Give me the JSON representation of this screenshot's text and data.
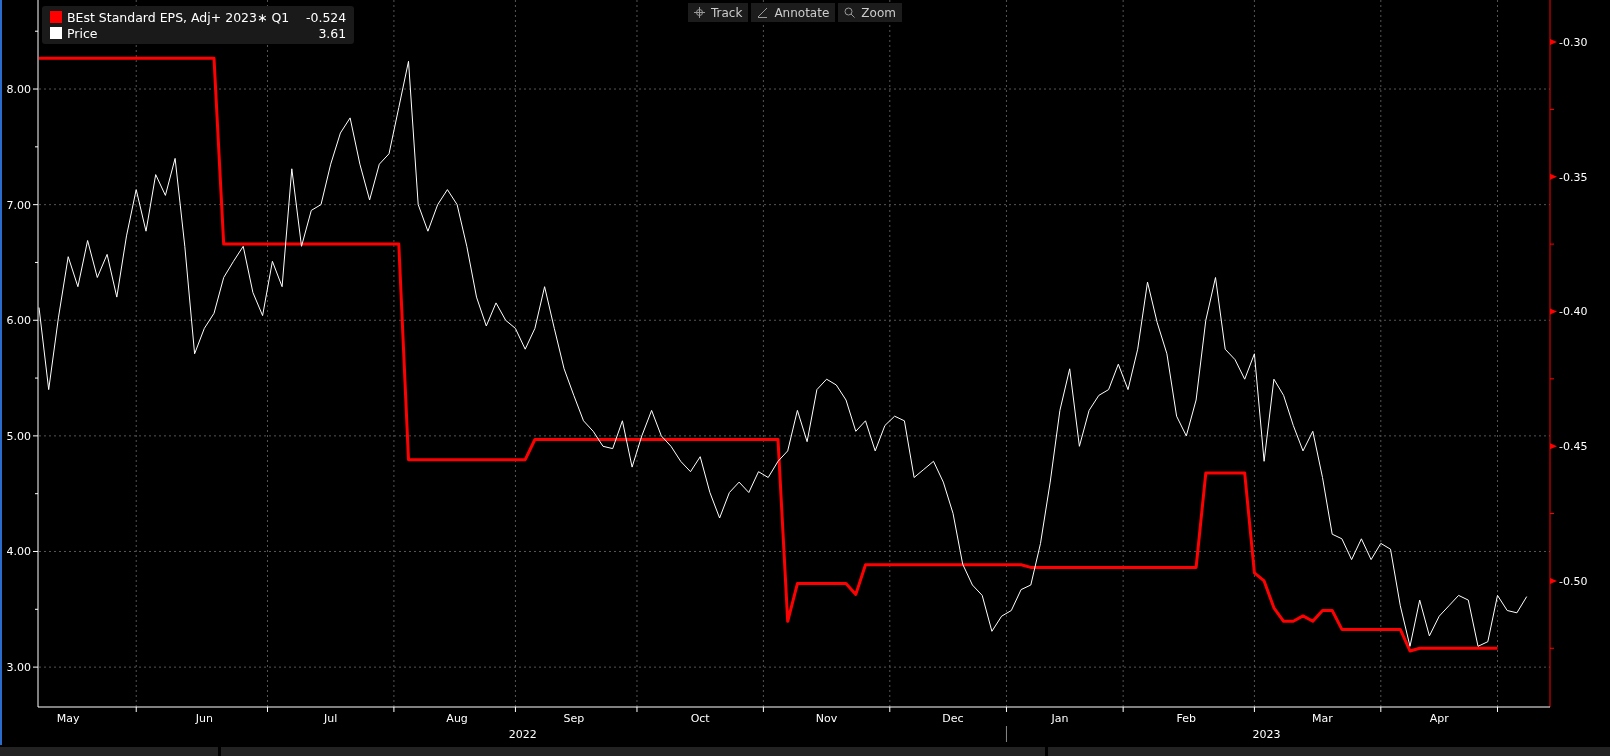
{
  "legend": [
    {
      "value": "-0.524"
    },
    {
      "value": "3.61"
    }
  ],
  "toolbar": [
    {
      "kind": "track",
      "label": "Track"
    },
    {
      "kind": "annotate",
      "label": "Annotate"
    },
    {
      "kind": "zoom",
      "label": "Zoom"
    }
  ],
  "chart_data": {
    "type": "line",
    "categories": [
      null,
      null,
      null,
      "May",
      null,
      null,
      null,
      null,
      null,
      null,
      null,
      null,
      null,
      null,
      null,
      null,
      null,
      "Jun",
      null,
      null,
      null,
      null,
      null,
      null,
      null,
      null,
      null,
      null,
      null,
      null,
      "Jul",
      null,
      null,
      null,
      null,
      null,
      null,
      null,
      null,
      null,
      null,
      null,
      null,
      "Aug",
      null,
      null,
      null,
      null,
      null,
      null,
      null,
      null,
      null,
      null,
      null,
      "Sep",
      null,
      null,
      null,
      null,
      null,
      null,
      null,
      null,
      null,
      null,
      null,
      null,
      "Oct",
      null,
      null,
      null,
      null,
      null,
      null,
      null,
      null,
      null,
      null,
      null,
      null,
      "Nov",
      null,
      null,
      null,
      null,
      null,
      null,
      null,
      null,
      null,
      null,
      null,
      null,
      "Dec",
      null,
      null,
      null,
      null,
      null,
      null,
      null,
      null,
      null,
      null,
      "Jan",
      null,
      null,
      null,
      null,
      null,
      null,
      null,
      null,
      null,
      null,
      null,
      null,
      "Feb",
      null,
      null,
      null,
      null,
      null,
      null,
      null,
      null,
      null,
      null,
      null,
      null,
      null,
      "Mar",
      null,
      null,
      null,
      null,
      null,
      null,
      null,
      null,
      null,
      null,
      null,
      "Apr",
      null,
      null,
      null,
      null,
      null,
      null,
      null,
      null,
      null
    ],
    "series": [
      {
        "name": "BEst Standard EPS, Adj+ 2023∗ Q1",
        "axis": "y2",
        "color": "#ff0000",
        "values": [
          -0.306,
          -0.306,
          -0.306,
          -0.306,
          -0.306,
          -0.306,
          -0.306,
          -0.306,
          -0.306,
          -0.306,
          -0.306,
          -0.306,
          -0.306,
          -0.306,
          -0.306,
          -0.306,
          -0.306,
          -0.306,
          -0.306,
          -0.375,
          -0.375,
          -0.375,
          -0.375,
          -0.375,
          -0.375,
          -0.375,
          -0.375,
          -0.375,
          -0.375,
          -0.375,
          -0.375,
          -0.375,
          -0.375,
          -0.375,
          -0.375,
          -0.375,
          -0.375,
          -0.375,
          -0.455,
          -0.455,
          -0.455,
          -0.455,
          -0.455,
          -0.455,
          -0.455,
          -0.455,
          -0.455,
          -0.455,
          -0.455,
          -0.455,
          -0.455,
          -0.4475,
          -0.4475,
          -0.4475,
          -0.4475,
          -0.4475,
          -0.4475,
          -0.4475,
          -0.4475,
          -0.4475,
          -0.4475,
          -0.4475,
          -0.4475,
          -0.4475,
          -0.4475,
          -0.4475,
          -0.4475,
          -0.4475,
          -0.4475,
          -0.4475,
          -0.4475,
          -0.4475,
          -0.4475,
          -0.4475,
          -0.4475,
          -0.4475,
          -0.4475,
          -0.515,
          -0.501,
          -0.501,
          -0.501,
          -0.501,
          -0.501,
          -0.501,
          -0.505,
          -0.494,
          -0.494,
          -0.494,
          -0.494,
          -0.494,
          -0.494,
          -0.494,
          -0.494,
          -0.494,
          -0.494,
          -0.494,
          -0.494,
          -0.494,
          -0.494,
          -0.494,
          -0.494,
          -0.494,
          -0.495,
          -0.495,
          -0.495,
          -0.495,
          -0.495,
          -0.495,
          -0.495,
          -0.495,
          -0.495,
          -0.495,
          -0.495,
          -0.495,
          -0.495,
          -0.495,
          -0.495,
          -0.495,
          -0.495,
          -0.495,
          -0.46,
          -0.46,
          -0.46,
          -0.46,
          -0.46,
          -0.497,
          -0.5,
          -0.51,
          -0.515,
          -0.515,
          -0.513,
          -0.515,
          -0.511,
          -0.511,
          -0.518,
          -0.518,
          -0.518,
          -0.518,
          -0.518,
          -0.518,
          -0.518,
          -0.526,
          -0.525,
          -0.525,
          -0.525,
          -0.525,
          -0.525,
          -0.525,
          -0.525,
          -0.525,
          -0.525,
          null,
          null,
          null
        ]
      },
      {
        "name": "Price",
        "color": "#ffffff",
        "values": [
          6.11,
          5.4,
          6.02,
          6.55,
          6.29,
          6.69,
          6.37,
          6.57,
          6.2,
          6.73,
          7.13,
          6.77,
          7.26,
          7.08,
          7.4,
          6.64,
          5.71,
          5.93,
          6.06,
          6.37,
          6.51,
          6.64,
          6.24,
          6.04,
          6.51,
          6.29,
          7.31,
          6.64,
          6.95,
          7.0,
          7.35,
          7.62,
          7.75,
          7.35,
          7.04,
          7.35,
          7.44,
          7.84,
          8.24,
          7.0,
          6.77,
          7.0,
          7.13,
          7.0,
          6.64,
          6.2,
          5.95,
          6.15,
          6.0,
          5.93,
          5.75,
          5.93,
          6.29,
          5.93,
          5.58,
          5.35,
          5.13,
          5.04,
          4.91,
          4.89,
          5.13,
          4.73,
          5.0,
          5.22,
          5.0,
          4.91,
          4.78,
          4.69,
          4.82,
          4.51,
          4.29,
          4.51,
          4.6,
          4.51,
          4.69,
          4.64,
          4.78,
          4.87,
          5.22,
          4.95,
          5.4,
          5.49,
          5.44,
          5.31,
          5.04,
          5.13,
          4.87,
          5.09,
          5.17,
          5.13,
          4.64,
          4.71,
          4.78,
          4.6,
          4.33,
          3.89,
          3.71,
          3.62,
          3.31,
          3.44,
          3.49,
          3.67,
          3.71,
          4.07,
          4.6,
          5.22,
          5.58,
          4.91,
          5.22,
          5.35,
          5.4,
          5.62,
          5.4,
          5.75,
          6.33,
          5.98,
          5.71,
          5.17,
          5.0,
          5.31,
          6.0,
          6.37,
          5.75,
          5.66,
          5.49,
          5.71,
          4.78,
          5.49,
          5.35,
          5.09,
          4.87,
          5.04,
          4.64,
          4.15,
          4.11,
          3.93,
          4.11,
          3.93,
          4.07,
          4.02,
          3.53,
          3.18,
          3.58,
          3.27,
          3.44,
          3.53,
          3.62,
          3.58,
          3.18,
          3.22,
          3.62,
          3.49,
          3.47,
          3.61
        ]
      }
    ],
    "ylim": [
      2.655,
      8.77
    ],
    "y2lim": [
      -0.5468,
      -0.2844
    ],
    "annotations": [
      "2022",
      "2023"
    ],
    "grid": true,
    "yticks": [
      {
        "value": 3,
        "label": "3.00"
      },
      {
        "value": 4,
        "label": "4.00"
      },
      {
        "value": 5,
        "label": "5.00"
      },
      {
        "value": 6,
        "label": "6.00"
      },
      {
        "value": 7,
        "label": "7.00"
      },
      {
        "value": 8,
        "label": "8.00"
      }
    ],
    "y2ticks": [
      {
        "value": -0.3,
        "label": "-0.30"
      },
      {
        "value": -0.35,
        "label": "-0.35"
      },
      {
        "value": -0.4,
        "label": "-0.40"
      },
      {
        "value": -0.45,
        "label": "-0.45"
      },
      {
        "value": -0.5,
        "label": "-0.50"
      }
    ]
  }
}
